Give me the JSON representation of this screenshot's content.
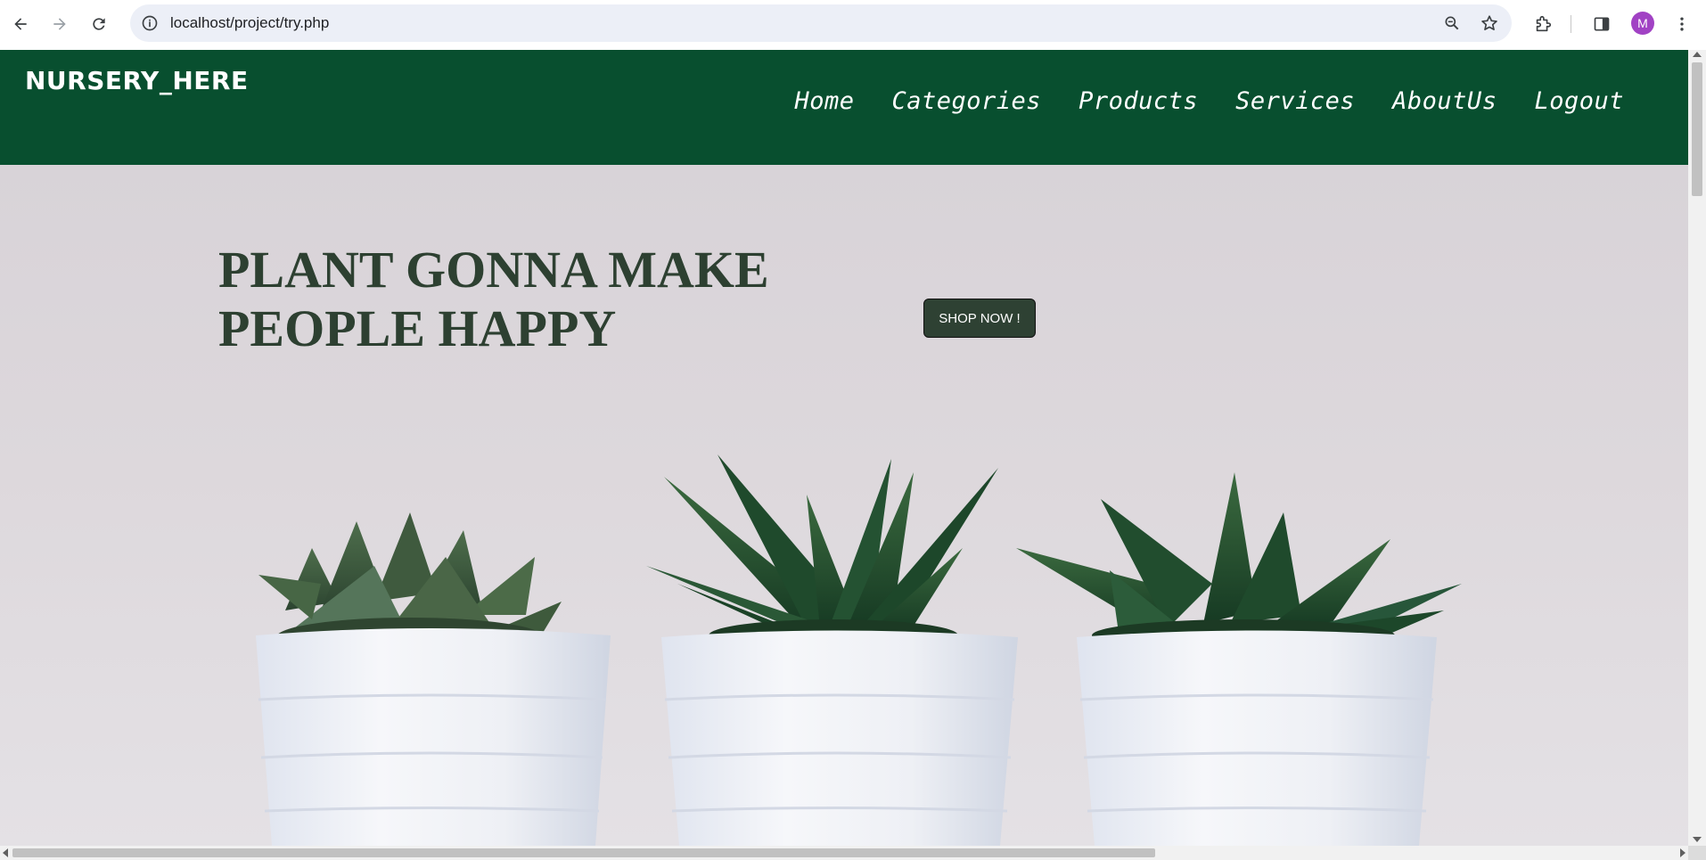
{
  "browser": {
    "url": "localhost/project/try.php",
    "profile_initial": "M",
    "profile_color": "#a142c4"
  },
  "site": {
    "logo": "NURSERY_HERE",
    "header_color": "#084f2f",
    "menu": [
      {
        "label": "Home"
      },
      {
        "label": "Categories"
      },
      {
        "label": "Products"
      },
      {
        "label": "Services"
      },
      {
        "label": "AboutUs"
      },
      {
        "label": "Logout"
      }
    ]
  },
  "hero": {
    "title_line1": "PLANT GONNA MAKE",
    "title_line2": "PEOPLE HAPPY",
    "cta": "SHOP NOW !",
    "title_color": "#2d4031"
  }
}
